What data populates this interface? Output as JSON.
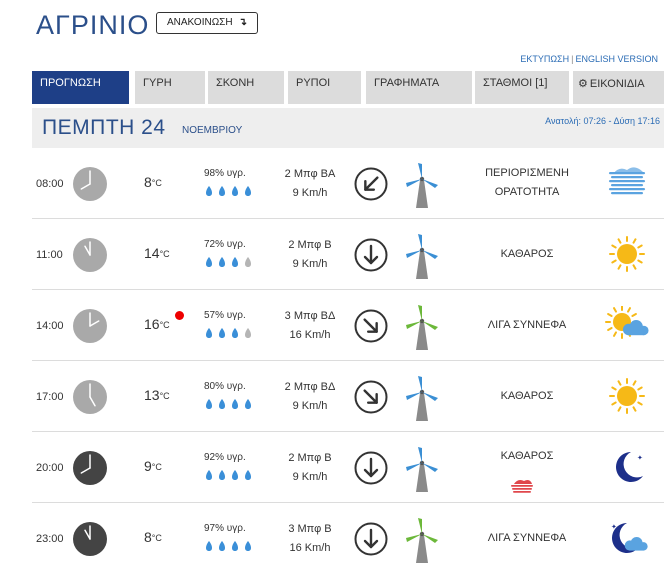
{
  "header": {
    "city": "ΑΓΡΙΝΙΟ",
    "announcement_button": "ΑΝΑΚΟΙΝΩΣΗ",
    "print_link": "ΕΚΤΥΠΩΣΗ",
    "english_link": "ENGLISH VERSION"
  },
  "tabs": [
    {
      "label": "ΠΡΟΓΝΩΣΗ",
      "active": true
    },
    {
      "label": "ΓΥΡΗ",
      "active": false
    },
    {
      "label": "ΣΚΟΝΗ",
      "active": false
    },
    {
      "label": "ΡΥΠΟΙ",
      "active": false
    },
    {
      "label": "ΓΡΑΦΗΜΑΤΑ",
      "active": false
    },
    {
      "label": "ΣΤΑΘΜΟΙ [1]",
      "active": false
    },
    {
      "label": "ΕΙΚΟΝΙΔΙΑ",
      "active": false,
      "icon": "gear-icon"
    }
  ],
  "day": {
    "title": "ΠΕΜΠΤΗ 24",
    "month": "ΝΟΕΜΒΡΙΟΥ",
    "sun": "Ανατολή: 07:26 - Δύση 17:16"
  },
  "rows": [
    {
      "time": "08:00",
      "hour": 8,
      "night": false,
      "temp": "8",
      "unit": "°C",
      "alert": false,
      "humidity": "98% υγρ.",
      "drops": 4,
      "wind": "2 Μπφ ΒΑ",
      "speed": "9 Km/h",
      "direction_deg": 45,
      "turbine": "blue",
      "condition": [
        "ΠΕΡΙΟΡΙΣΜΕΝΗ",
        "ΟΡΑΤΟΤΗΤΑ"
      ],
      "icon": "fog-icon"
    },
    {
      "time": "11:00",
      "hour": 11,
      "night": false,
      "temp": "14",
      "unit": "°C",
      "alert": false,
      "humidity": "72% υγρ.",
      "drops": 3,
      "wind": "2 Μπφ Β",
      "speed": "9 Km/h",
      "direction_deg": 0,
      "turbine": "blue",
      "condition": [
        "ΚΑΘΑΡΟΣ"
      ],
      "icon": "sun-icon"
    },
    {
      "time": "14:00",
      "hour": 14,
      "night": false,
      "temp": "16",
      "unit": "°C",
      "alert": true,
      "humidity": "57% υγρ.",
      "drops": 3,
      "wind": "3 Μπφ ΒΔ",
      "speed": "16 Km/h",
      "direction_deg": 315,
      "turbine": "green",
      "condition": [
        "ΛΙΓΑ ΣΥΝΝΕΦΑ"
      ],
      "icon": "sun-cloud-icon"
    },
    {
      "time": "17:00",
      "hour": 17,
      "night": false,
      "temp": "13",
      "unit": "°C",
      "alert": false,
      "humidity": "80% υγρ.",
      "drops": 4,
      "wind": "2 Μπφ ΒΔ",
      "speed": "9 Km/h",
      "direction_deg": 315,
      "turbine": "blue",
      "condition": [
        "ΚΑΘΑΡΟΣ"
      ],
      "icon": "sun-icon"
    },
    {
      "time": "20:00",
      "hour": 20,
      "night": true,
      "temp": "9",
      "unit": "°C",
      "alert": false,
      "humidity": "92% υγρ.",
      "drops": 4,
      "wind": "2 Μπφ Β",
      "speed": "9 Km/h",
      "direction_deg": 0,
      "turbine": "blue",
      "condition": [
        "ΚΑΘΑΡΟΣ"
      ],
      "icon": "moon-icon",
      "extra_icon": "red-haze-icon"
    },
    {
      "time": "23:00",
      "hour": 23,
      "night": true,
      "temp": "8",
      "unit": "°C",
      "alert": false,
      "humidity": "97% υγρ.",
      "drops": 4,
      "wind": "3 Μπφ Β",
      "speed": "16 Km/h",
      "direction_deg": 0,
      "turbine": "green",
      "condition": [
        "ΛΙΓΑ ΣΥΝΝΕΦΑ"
      ],
      "icon": "moon-cloud-icon"
    }
  ],
  "colors": {
    "brand": "#1e3f87",
    "link": "#2b6cb5",
    "drop": "#3a8fd8",
    "sun": "#f6b917",
    "moon": "#1d2f8a"
  }
}
